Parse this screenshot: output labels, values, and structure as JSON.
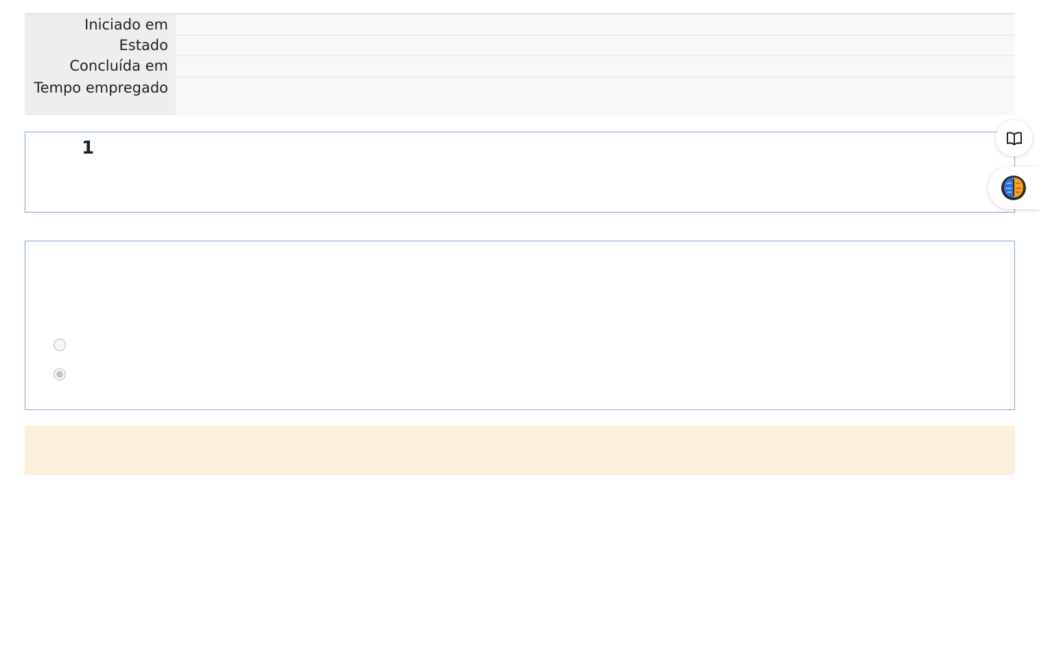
{
  "summary": {
    "rows": [
      {
        "label": "Iniciado em",
        "value": ""
      },
      {
        "label": "Estado",
        "value": ""
      },
      {
        "label": "Concluída em",
        "value": ""
      },
      {
        "label": "Tempo empregado",
        "value": ""
      }
    ]
  },
  "question": {
    "number": "1",
    "options": [
      {
        "label": "",
        "checked": false
      },
      {
        "label": "",
        "checked": true
      }
    ]
  },
  "feedback": {
    "text": ""
  },
  "floating_buttons": [
    {
      "icon": "book-open-icon"
    },
    {
      "icon": "brain-icon"
    }
  ]
}
